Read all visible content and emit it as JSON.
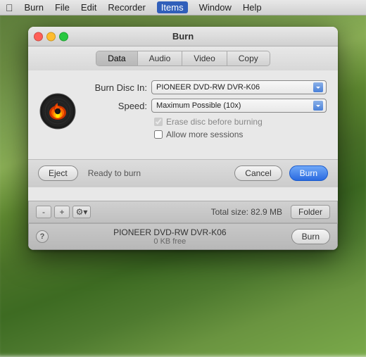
{
  "menubar": {
    "apple_symbol": "⌘",
    "items": [
      {
        "label": "Burn",
        "active": false
      },
      {
        "label": "File",
        "active": false
      },
      {
        "label": "Edit",
        "active": false
      },
      {
        "label": "Recorder",
        "active": false
      },
      {
        "label": "Items",
        "active": true
      },
      {
        "label": "Window",
        "active": false
      },
      {
        "label": "Help",
        "active": false
      }
    ]
  },
  "window": {
    "title": "Burn",
    "tabs": [
      {
        "label": "Data",
        "active": true
      },
      {
        "label": "Audio",
        "active": false
      },
      {
        "label": "Video",
        "active": false
      },
      {
        "label": "Copy",
        "active": false
      }
    ],
    "burn_disc_in_label": "Burn Disc In:",
    "burn_disc_in_value": "PIONEER DVD-RW DVR-K06",
    "speed_label": "Speed:",
    "speed_value": "Maximum Possible (10x)",
    "erase_label": "Erase disc before burning",
    "sessions_label": "Allow more sessions",
    "eject_label": "Eject",
    "status_text": "Ready to burn",
    "cancel_label": "Cancel",
    "burn_label": "Burn"
  },
  "toolbar": {
    "minus_label": "-",
    "plus_label": "+",
    "gear_label": "⚙▾",
    "size_text": "Total size: 82.9 MB",
    "folder_label": "Folder"
  },
  "statusbar": {
    "help_label": "?",
    "disc_name": "PIONEER DVD-RW DVR-K06",
    "disc_space": "0 KB free",
    "burn_label": "Burn"
  }
}
